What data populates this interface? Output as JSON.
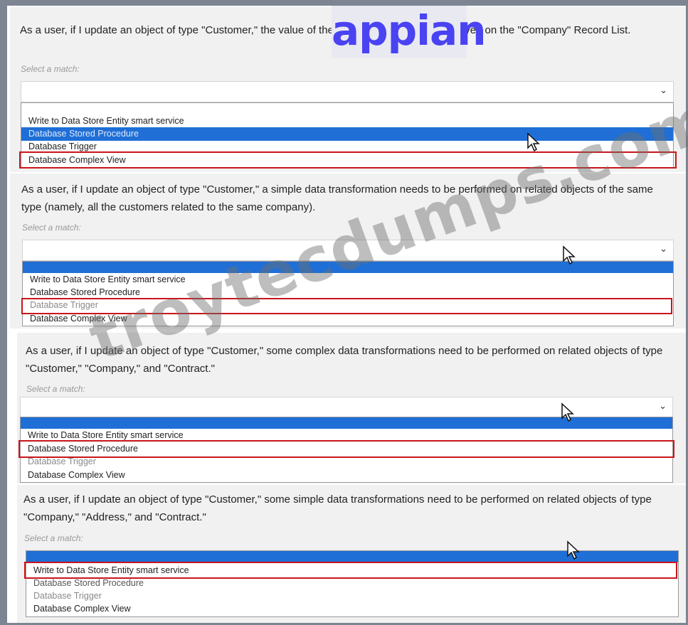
{
  "logo": {
    "text": "appian"
  },
  "watermark": {
    "text": "troytecdumps.com"
  },
  "blocks": [
    {
      "question": "As a user, if I update an object of type \"Customer,\" the value of the given field should be displayed on the \"Company\" Record List.",
      "select_label": "Select a match:",
      "options": [
        "Write to Data Store Entity smart service",
        "Database Stored Procedure",
        "Database Trigger",
        "Database Complex View"
      ],
      "highlighted_option": "Database Stored Procedure",
      "boxed_option": "Database Complex View"
    },
    {
      "question": "As a user, if I update an object of type \"Customer,\" a simple data transformation needs to be performed on related objects of the same type (namely, all the customers related to the same company).",
      "select_label": "Select a match:",
      "options": [
        "Write to Data Store Entity smart service",
        "Database Stored Procedure",
        "Database Trigger",
        "Database Complex View"
      ],
      "boxed_option": "Database Trigger"
    },
    {
      "question": "As a user, if I update an object of type \"Customer,\" some complex data transformations need to be performed on related objects of type \"Customer,\" \"Company,\" and \"Contract.\"",
      "select_label": "Select a match:",
      "options": [
        "Write to Data Store Entity smart service",
        "Database Stored Procedure",
        "Database Trigger",
        "Database Complex View"
      ],
      "boxed_option": "Database Stored Procedure"
    },
    {
      "question": "As a user, if I update an object of type \"Customer,\" some simple data transformations need to be performed on related objects of type \"Company,\" \"Address,\" and \"Contract.\"",
      "select_label": "Select a match:",
      "options": [
        "Write to Data Store Entity smart service",
        "Database Stored Procedure",
        "Database Trigger",
        "Database Complex View"
      ],
      "boxed_option": "Write to Data Store Entity smart service"
    }
  ],
  "icons": {
    "dropdown": "chevron-down-icon",
    "pointer": "mouse-cursor-icon"
  },
  "colors": {
    "selection": "#1f6fd6",
    "answer_box": "#c9151b",
    "logo": "#4a43f2"
  }
}
